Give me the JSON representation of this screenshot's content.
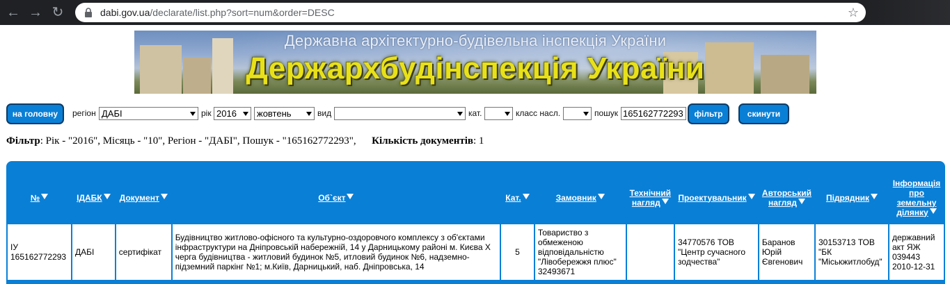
{
  "browser": {
    "url_host": "dabi.gov.ua",
    "url_path": "/declarate/list.php?sort=num&order=DESC"
  },
  "banner": {
    "subtitle": "Державна архітектурно-будівельна інспекція України",
    "title": "Держархбудінспекція України"
  },
  "toolbar": {
    "home_button": "на головну",
    "region_label": "регіон",
    "region_value": "ДАБІ",
    "year_label": "рік",
    "year_value": "2016",
    "month_value": "жовтень",
    "type_label": "вид",
    "type_value": "",
    "cat_label": "кат.",
    "cat_value": "",
    "class_label": "класс насл.",
    "class_value": "",
    "search_label": "пошук",
    "search_value": "165162772293",
    "filter_button": "фільтр",
    "reset_button": "скинути"
  },
  "summary": {
    "filter_bold": "Фільтр",
    "filter_text": ": Рік - \"2016\", Місяць - \"10\", Регіон - \"ДАБІ\", Пошук - \"165162772293\",",
    "count_bold": "Кількість документів",
    "count_text": ": 1"
  },
  "table": {
    "headers": [
      "№",
      "ІДАБК",
      "Документ",
      "Об`єкт",
      "Кат.",
      "Замовник",
      "Технічний нагляд",
      "Проектувальник",
      "Авторський нагляд",
      "Підрядник",
      "Інформація про земельну ділянку"
    ],
    "rows": [
      {
        "num": "ІУ 165162772293",
        "idabk": "ДАБІ",
        "doc": "сертифікат",
        "object": "Будівництво житлово-офісного та культурно-оздоровчого комплексу з об'єктами інфраструктури на Дніпровській набережній, 14 у Дарницькому районі м. Києва Х черга будівництва - житловий будинок №5, итловий будинок №6, надземно-підземний паркінг №1; м.Київ, Дарницький, наб. Дніпровська, 14",
        "cat": "5",
        "customer": "Товариство з обмеженою відповідальністю \"Лівобережжя плюс\" 32493671",
        "tech_supervision": "",
        "designer": "34770576 ТОВ \"Центр сучасного зодчества\"",
        "author_supervision": "Баранов Юрій Євгенович",
        "contractor": "30153713 ТОВ \"БК \"Міськжитлобуд\"",
        "land_info": "державний акт ЯЖ 039443 2010-12-31"
      }
    ]
  },
  "colors": {
    "accent": "#0a7fd6",
    "banner_title": "#e8e11a"
  }
}
